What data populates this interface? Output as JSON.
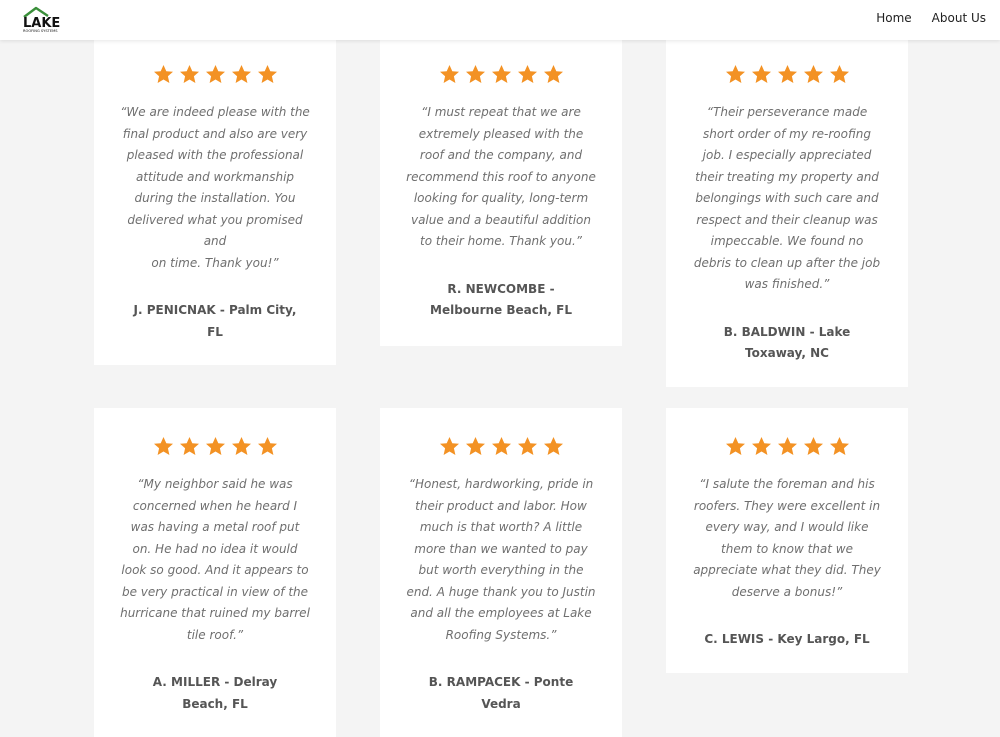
{
  "brand": {
    "logo_text": "LAKE",
    "logo_subtext": "ROOFING SYSTEMS",
    "logo_color": "#111111",
    "roof_color": "#3a8f3a"
  },
  "nav": {
    "items": [
      {
        "label": "Home"
      },
      {
        "label": "About Us"
      }
    ]
  },
  "colors": {
    "star": "#f39224",
    "quote_text": "#6f6f6f",
    "author_text": "#555555"
  },
  "testimonials": [
    {
      "rating": 5,
      "quote": "“We are indeed please with the final product and also are very pleased with the professional attitude and workmanship during the installation. You delivered what you promised and\non time. Thank you!”",
      "author": "J. PENICNAK - Palm City, FL"
    },
    {
      "rating": 5,
      "quote": "“I must repeat that we are extremely pleased with the roof and the company, and recommend this roof to anyone looking for quality, long-term value and a beautiful addition to their home. Thank you.”",
      "author": "R. NEWCOMBE - Melbourne Beach, FL"
    },
    {
      "rating": 5,
      "quote": "“Their perseverance made short order of my re-roofing job. I especially appreciated their treating my property and belongings with such care and respect and their cleanup was impeccable. We found no debris to clean up after the job was finished.”",
      "author": "B. BALDWIN - Lake Toxaway, NC"
    },
    {
      "rating": 5,
      "quote": "“My neighbor said he was concerned when he heard I was having a metal roof put on. He had no idea it would look so good. And it appears to be very practical in view of the hurricane that ruined my barrel tile roof.”",
      "author": "A. MILLER - Delray Beach, FL"
    },
    {
      "rating": 5,
      "quote": "“Honest, hardworking, pride in their product and labor. How much is that worth? A little more than we wanted to pay but worth everything in the end. A huge thank you to Justin and all the employees at Lake Roofing Systems.”",
      "author": "B. RAMPACEK - Ponte Vedra"
    },
    {
      "rating": 5,
      "quote": "“I salute the foreman and his roofers. They were excellent in every way, and  I would like them to know that we appreciate what they did. They deserve a bonus!”",
      "author": "C. LEWIS - Key Largo, FL"
    }
  ]
}
